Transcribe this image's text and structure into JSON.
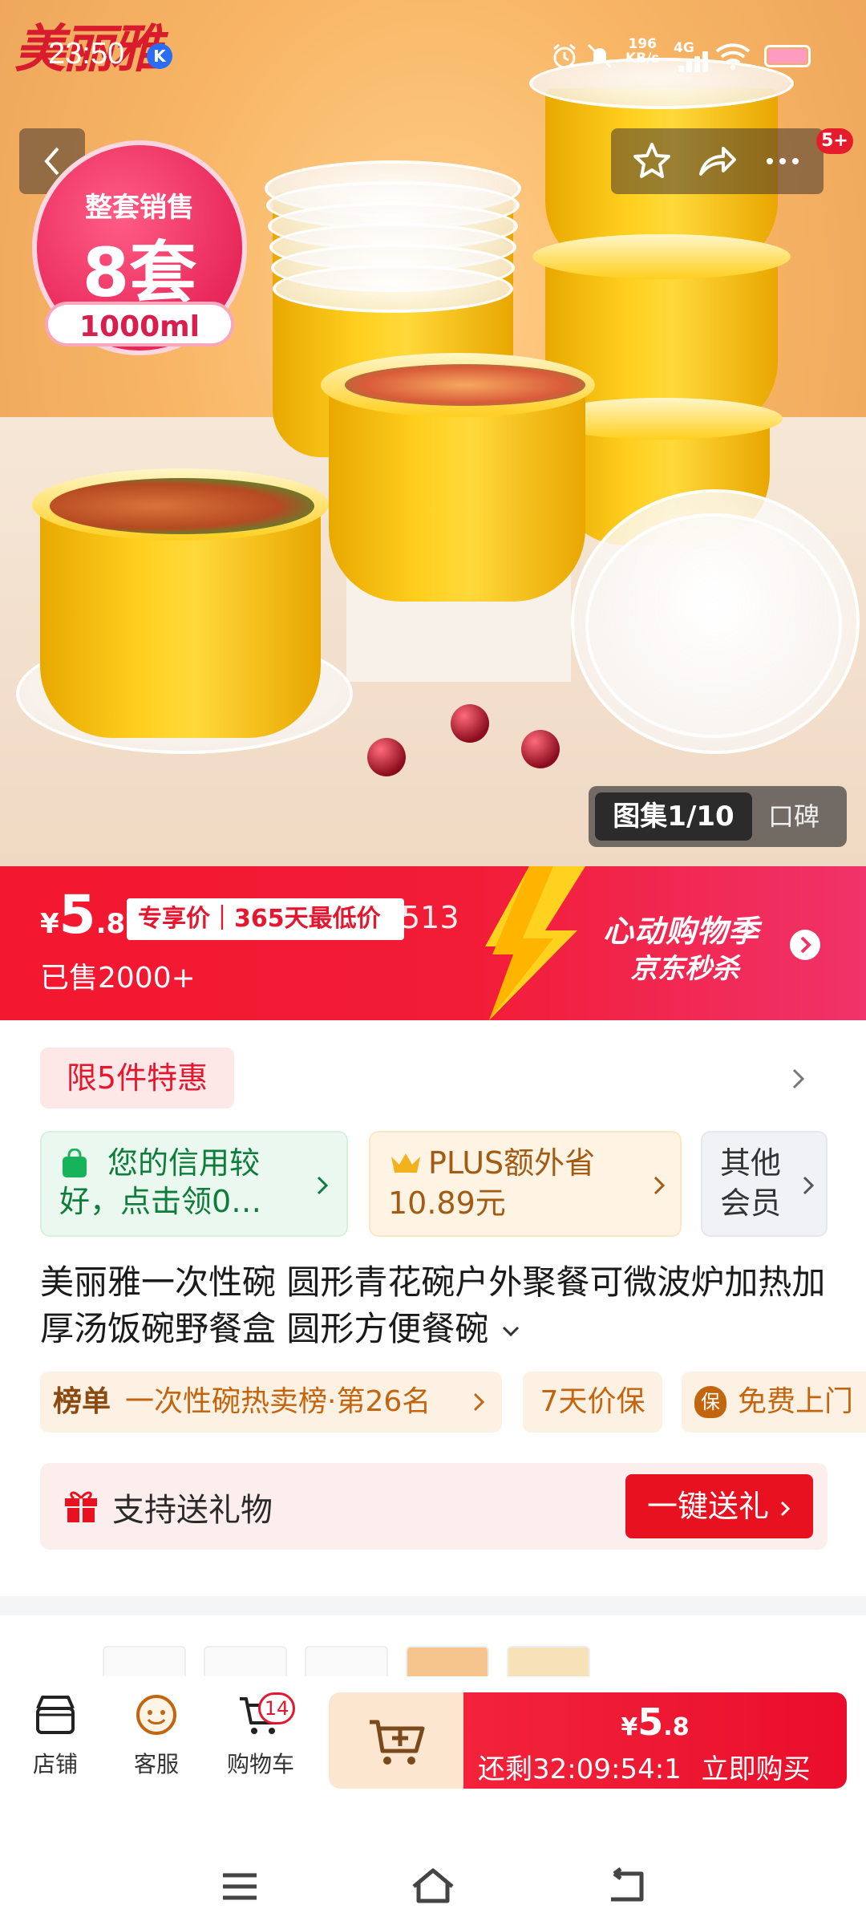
{
  "status_bar": {
    "time": "23:50",
    "k_badge": "K",
    "net_speed_value": "196",
    "net_speed_unit": "KB/s",
    "network": "4G"
  },
  "hero": {
    "brand": "美丽雅",
    "sticker_line1": "整套销售",
    "sticker_line2": "8套",
    "sticker_volume": "1000ml",
    "more_badge": "5+",
    "gallery_label": "图集1/10",
    "reviews_label": "口碑"
  },
  "price_banner": {
    "currency": "¥",
    "price_int": "5",
    "price_dec": ".8",
    "exclusive_tag": "专享价｜365天最低价",
    "trailing_text": "513",
    "sold": "已售2000+",
    "promo_title": "心动购物季",
    "promo_subtitle": "京东秒杀"
  },
  "info": {
    "limit_tag": "限5件特惠",
    "credit_card": "您的信用较好，点击领0…",
    "plus_line1": "PLUS额外省",
    "plus_line2": "10.89元",
    "other_member_line1": "其他",
    "other_member_line2": "会员",
    "product_title": "美丽雅一次性碗 圆形青花碗户外聚餐可微波炉加热加厚汤饭碗野餐盒 圆形方便餐碗",
    "rank_label": "榜单",
    "rank_value": "一次性碗热卖榜·第26名",
    "price_protect": "7天价保",
    "free_pickup_badge": "保",
    "free_pickup": "免费上门",
    "gift_text": "支持送礼物",
    "gift_button": "一键送礼"
  },
  "bottom_bar": {
    "store": "店铺",
    "service": "客服",
    "cart": "购物车",
    "cart_count": "14",
    "buy_currency": "¥",
    "buy_price_int": "5",
    "buy_price_dec": ".8",
    "countdown": "还剩32:09:54:1",
    "buy_now": "立即购买"
  },
  "colors": {
    "brand_red": "#e4172f",
    "promo_pink": "#f0336a",
    "plus_orange": "#c2650e",
    "credit_green": "#0fa14b"
  }
}
